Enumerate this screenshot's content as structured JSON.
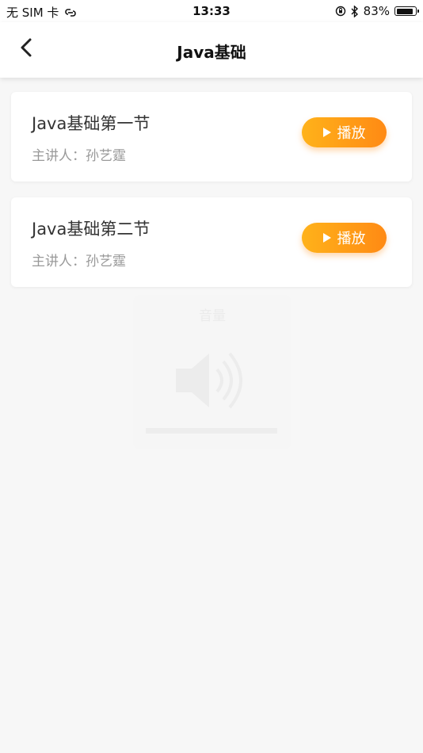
{
  "status_bar": {
    "carrier": "无 SIM 卡",
    "time": "13:33",
    "battery_percent": "83%",
    "battery_level": 0.83
  },
  "nav": {
    "title": "Java基础",
    "back_icon": "chevron-left-icon"
  },
  "lessons": [
    {
      "title": "Java基础第一节",
      "speaker": "主讲人：孙艺霆",
      "button_label": "播放"
    },
    {
      "title": "Java基础第二节",
      "speaker": "主讲人：孙艺霆",
      "button_label": "播放"
    }
  ],
  "volume_hud": {
    "label": "音量",
    "icon": "speaker-icon"
  },
  "colors": {
    "accent_start": "#ffb21a",
    "accent_end": "#ff8a14",
    "background": "#f7f7f7",
    "card": "#ffffff"
  }
}
